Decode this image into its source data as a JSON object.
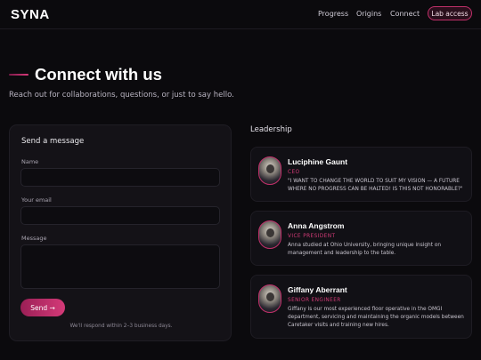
{
  "nav": {
    "brand": "SYNA",
    "links": [
      "Progress",
      "Origins",
      "Connect"
    ],
    "cta": "Lab access"
  },
  "hero": {
    "title": "Connect with us",
    "subtitle": "Reach out for collaborations, questions, or just to say hello."
  },
  "form": {
    "title": "Send a message",
    "name_label": "Name",
    "name_value": "",
    "email_label": "Your email",
    "email_value": "",
    "message_label": "Message",
    "message_value": "",
    "send_label": "Send →",
    "note": "We'll respond within 2–3 business days."
  },
  "leadership": {
    "title": "Leadership",
    "members": [
      {
        "name": "Luciphine Gaunt",
        "role": "CEO",
        "bio": "\"I WANT TO CHANGE THE WORLD TO SUIT MY VISION — A FUTURE WHERE NO PROGRESS CAN BE HALTED! IS THIS NOT HONORABLE?\""
      },
      {
        "name": "Anna Angstrom",
        "role": "VICE PRESIDENT",
        "bio": "Anna studied at Ohio University, bringing unique insight on management and leadership to the table."
      },
      {
        "name": "Giffany Aberrant",
        "role": "SENIOR ENGINEER",
        "bio": "Giffany is our most experienced floor operative in the OMGI department, servicing and maintaining the organic models between Caretaker visits and training new hires."
      }
    ]
  },
  "colors": {
    "background": "#0b0a0d",
    "accent": "#d13a76",
    "card": "#141217"
  }
}
